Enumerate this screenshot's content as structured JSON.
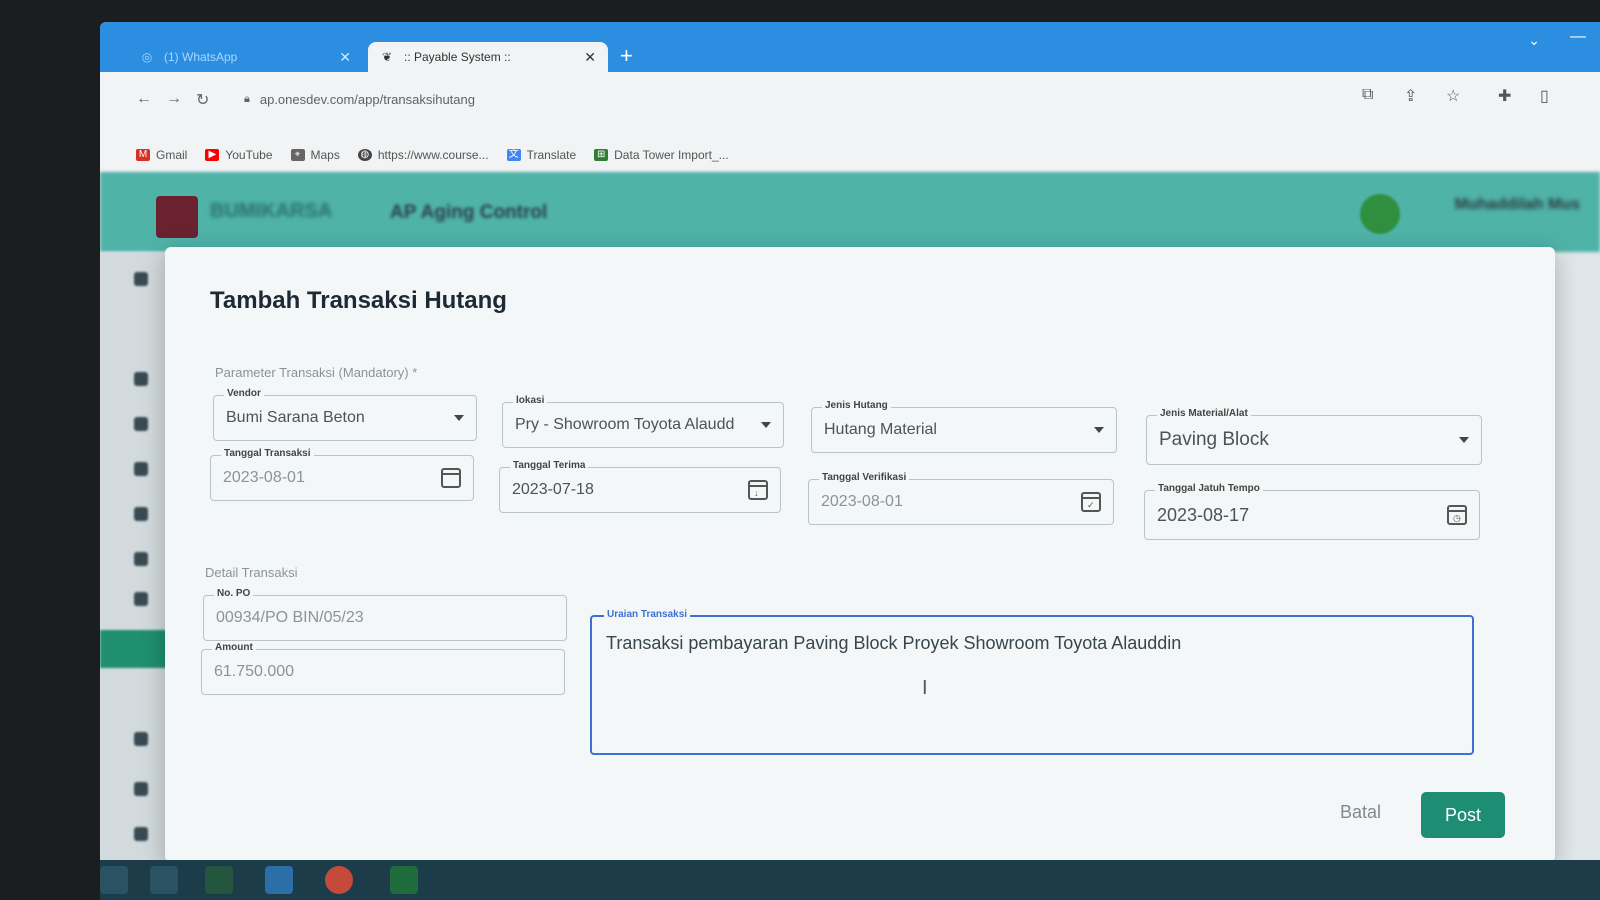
{
  "browser": {
    "tabs": [
      {
        "title": "(1) WhatsApp",
        "active": false
      },
      {
        "title": ":: Payable System ::",
        "active": true
      }
    ],
    "new_tab": "+",
    "url": "ap.onesdev.com/app/transaksihutang",
    "bookmarks": [
      {
        "label": "Gmail",
        "icon": "gmail-icon",
        "color": "#d93025"
      },
      {
        "label": "YouTube",
        "icon": "youtube-icon",
        "color": "#ff0000"
      },
      {
        "label": "Maps",
        "icon": "maps-icon",
        "color": "#555555"
      },
      {
        "label": "https://www.course...",
        "icon": "globe-icon",
        "color": "#555555"
      },
      {
        "label": "Translate",
        "icon": "translate-icon",
        "color": "#4285f4"
      },
      {
        "label": "Data Tower Import_...",
        "icon": "datatower-icon",
        "color": "#2e7d32"
      }
    ]
  },
  "app": {
    "brand": "BUMIKARSA",
    "title": "AP Aging Control",
    "user": "Muhaddilah Mus"
  },
  "modal": {
    "title": "Tambah Transaksi Hutang",
    "section_mandatory": "Parameter Transaksi (Mandatory) *",
    "section_detail": "Detail Transaksi",
    "fields": {
      "vendor": {
        "label": "Vendor",
        "value": "Bumi Sarana Beton"
      },
      "lokasi": {
        "label": "lokasi",
        "value": "Pry - Showroom Toyota Alaudd"
      },
      "jenis_hutang": {
        "label": "Jenis Hutang",
        "value": "Hutang Material"
      },
      "jenis_material": {
        "label": "Jenis Material/Alat",
        "value": "Paving Block"
      },
      "tanggal_transaksi": {
        "label": "Tanggal Transaksi",
        "value": "2023-08-01"
      },
      "tanggal_terima": {
        "label": "Tanggal Terima",
        "value": "2023-07-18"
      },
      "tanggal_verifikasi": {
        "label": "Tanggal Verifikasi",
        "value": "2023-08-01"
      },
      "tanggal_jatuh_tempo": {
        "label": "Tanggal Jatuh Tempo",
        "value": "2023-08-17"
      },
      "no_po": {
        "label": "No. PO",
        "value": "00934/PO BIN/05/23"
      },
      "amount": {
        "label": "Amount",
        "value": "61.750.000"
      },
      "uraian": {
        "label": "Uraian Transaksi",
        "value": "Transaksi pembayaran Paving Block Proyek Showroom Toyota Alauddin"
      }
    },
    "buttons": {
      "cancel": "Batal",
      "submit": "Post"
    }
  },
  "colors": {
    "primary": "#1d8e73",
    "focus": "#3f6fd1",
    "tab_bar": "#2c8ee0"
  }
}
